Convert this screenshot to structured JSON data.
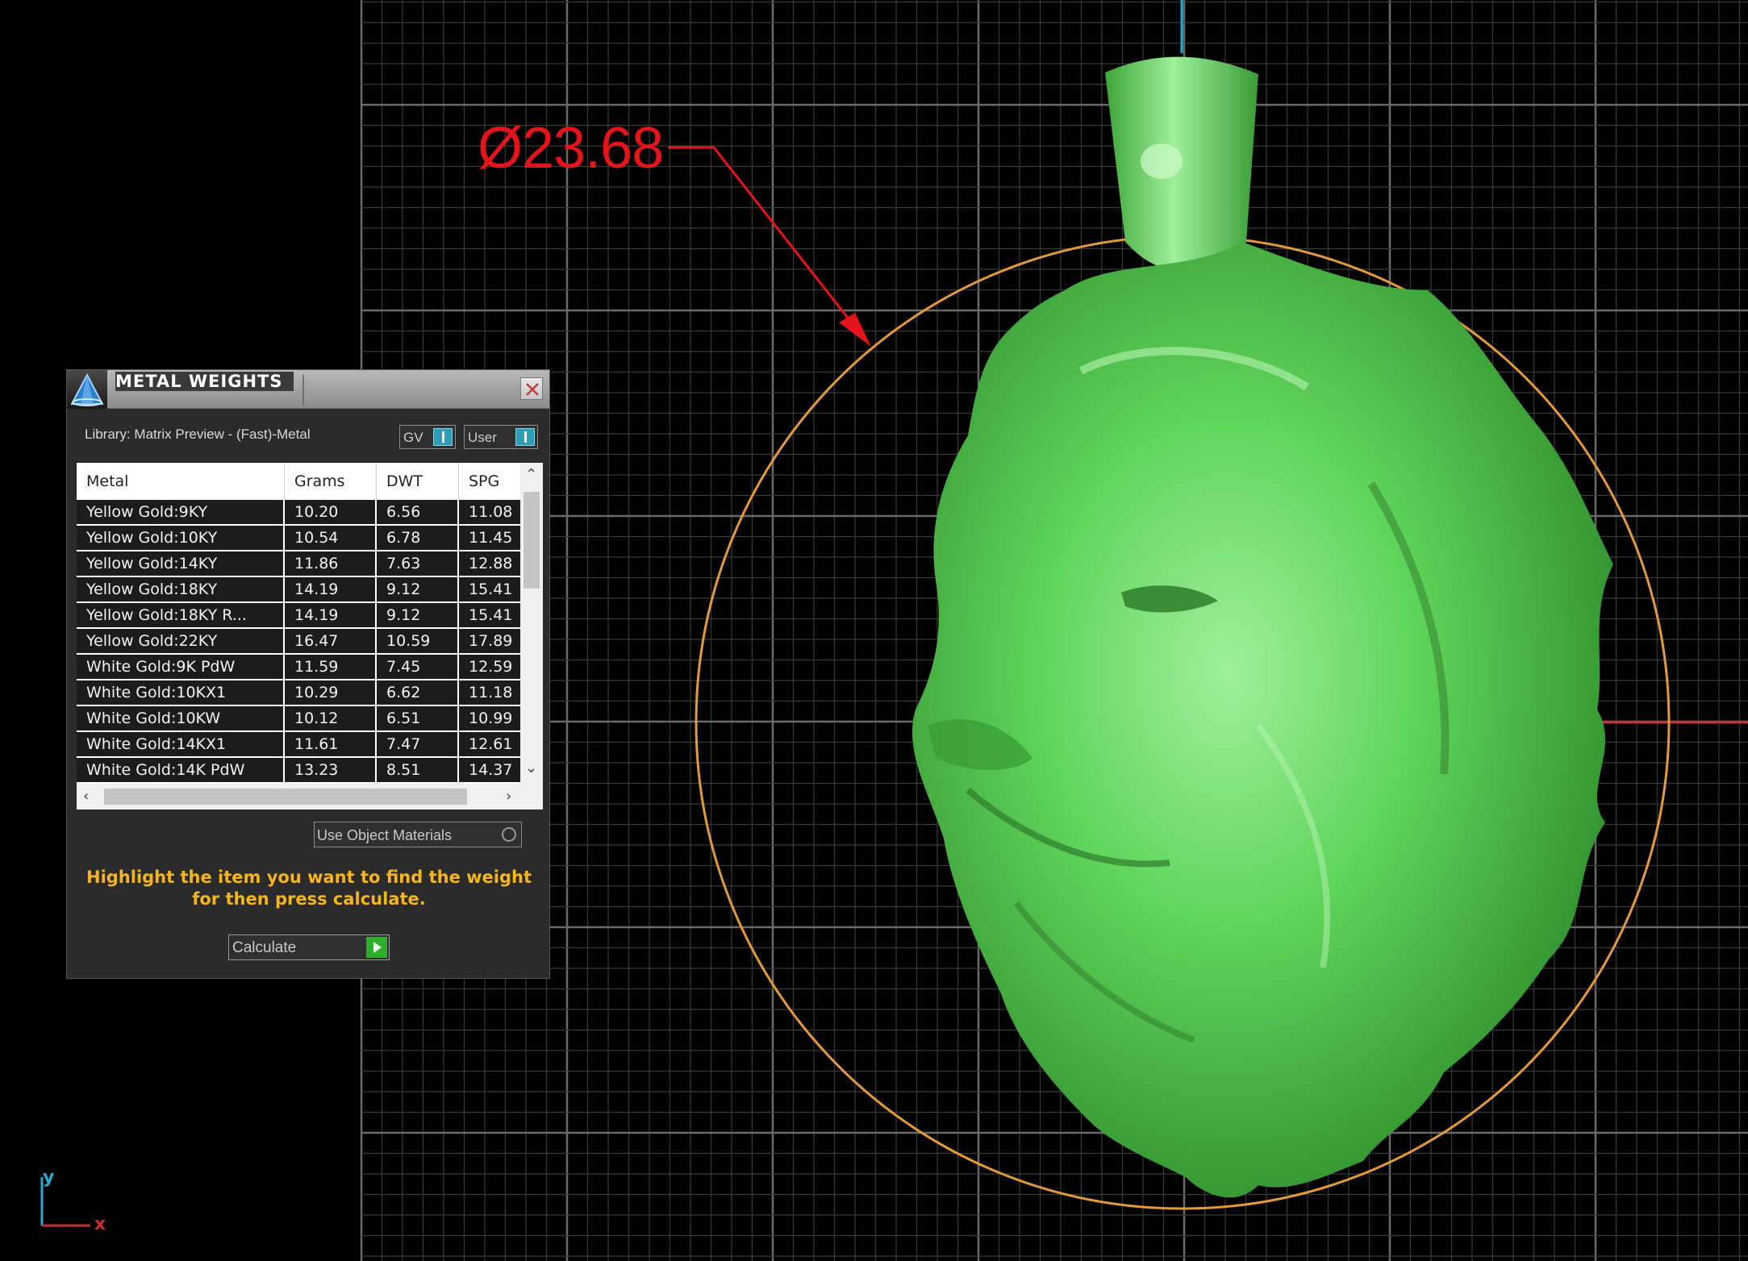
{
  "viewport": {
    "dimension_label": "Ø23.68",
    "axis_y_label": "y",
    "axis_x_label": "x",
    "model": "lion-head-pendant",
    "colors": {
      "background": "#000000",
      "grid": "#5a5a5a",
      "model": "#5fd45a",
      "dimension": "#e3141a",
      "circle": "#e39a3c",
      "axis_y": "#2aa7c9",
      "axis_x": "#c8302b"
    }
  },
  "panel": {
    "title": "METAL WEIGHTS",
    "logo_icon": "matrix-logo-icon",
    "close_icon": "close-icon",
    "library": "Library: Matrix Preview - (Fast)-Metal",
    "toggles": {
      "gv": "GV",
      "user": "User"
    },
    "table": {
      "columns": [
        "Metal",
        "Grams",
        "DWT",
        "SPG"
      ],
      "rows": [
        [
          "Yellow Gold:9KY",
          "10.20",
          "6.56",
          "11.08"
        ],
        [
          "Yellow Gold:10KY",
          "10.54",
          "6.78",
          "11.45"
        ],
        [
          "Yellow Gold:14KY",
          "11.86",
          "7.63",
          "12.88"
        ],
        [
          "Yellow Gold:18KY",
          "14.19",
          "9.12",
          "15.41"
        ],
        [
          "Yellow Gold:18KY R...",
          "14.19",
          "9.12",
          "15.41"
        ],
        [
          "Yellow Gold:22KY",
          "16.47",
          "10.59",
          "17.89"
        ],
        [
          "White Gold:9K PdW",
          "11.59",
          "7.45",
          "12.59"
        ],
        [
          "White Gold:10KX1",
          "10.29",
          "6.62",
          "11.18"
        ],
        [
          "White Gold:10KW",
          "10.12",
          "6.51",
          "10.99"
        ],
        [
          "White Gold:14KX1",
          "11.61",
          "7.47",
          "12.61"
        ],
        [
          "White Gold:14K PdW",
          "13.23",
          "8.51",
          "14.37"
        ]
      ]
    },
    "use_object_materials": "Use Object Materials",
    "hint": "Highlight the item you want to find the weight for then press calculate.",
    "calculate": "Calculate",
    "colors": {
      "accent": "#2c9fb7",
      "hint": "#f4b51d",
      "go": "#2eae2a"
    }
  }
}
